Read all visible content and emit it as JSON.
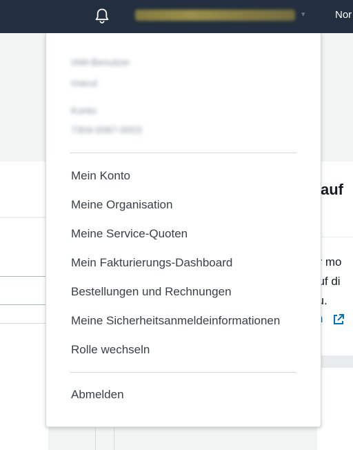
{
  "topbar": {
    "account_label": "rnacul @ 7304 0087 0003",
    "region_label": "Nor"
  },
  "background": {
    "title_fragment": "auf",
    "info_lines": [
      "er mo",
      "auf di",
      "zu."
    ],
    "link_fragment": "n"
  },
  "dropdown": {
    "account_info": [
      {
        "label": "IAM-Benutzer",
        "value": "rnacul"
      },
      {
        "label": "Konto",
        "value": "7304-0087-0003"
      }
    ],
    "items": [
      "Mein Konto",
      "Meine Organisation",
      "Meine Service-Quoten",
      "Mein Fakturierungs-Dashboard",
      "Bestellungen und Rechnungen",
      "Meine Sicherheitsanmeldeinformationen",
      "Rolle wechseln"
    ],
    "signout_label": "Abmelden"
  },
  "colors": {
    "nav_background": "#232f3e",
    "link": "#0073bb"
  },
  "icons": [
    "bell-icon",
    "chevron-down-icon",
    "external-link-icon"
  ]
}
